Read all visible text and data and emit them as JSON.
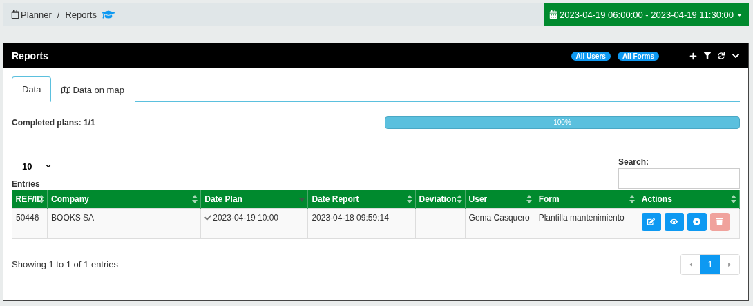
{
  "breadcrumb": {
    "items": [
      "Planner",
      "Reports"
    ],
    "separator": "/"
  },
  "date_range": {
    "label": "2023-04-19 06:00:00 - 2023-04-19 11:30:00"
  },
  "panel": {
    "title": "Reports",
    "badges": [
      "All Users",
      "All Forms"
    ]
  },
  "tabs": [
    {
      "label": "Data",
      "selected": true
    },
    {
      "label": "Data on map",
      "selected": false
    }
  ],
  "progress": {
    "label": "Completed plans: 1/1",
    "level": 1,
    "reading": "100%"
  },
  "page_size": {
    "value": "10",
    "label": "Entries"
  },
  "search": {
    "label": "Search:"
  },
  "table": {
    "columns": [
      {
        "label": "REF/ID",
        "sorted_desc": false
      },
      {
        "label": "Company",
        "sorted_desc": false
      },
      {
        "label": "Date Plan",
        "sorted_desc": true
      },
      {
        "label": "Date Report",
        "sorted_desc": false
      },
      {
        "label": "Deviation",
        "sorted_desc": false
      },
      {
        "label": "User",
        "sorted_desc": false
      },
      {
        "label": "Form",
        "sorted_desc": false
      },
      {
        "label": "Actions",
        "sorted_desc": false
      }
    ],
    "rows": [
      {
        "ref": "50446",
        "company": "BOOKS SA",
        "date_plan": "2023-04-19 10:00",
        "plan_checked": true,
        "date_report": "2023-04-18 09:59:14",
        "user": "Gema Casquero",
        "form": "Plantilla mantenimiento",
        "actions": [
          {
            "kind": "edit",
            "disabled": false
          },
          {
            "kind": "view",
            "disabled": false
          },
          {
            "kind": "target",
            "disabled": false
          },
          {
            "kind": "delete",
            "disabled": true
          }
        ]
      }
    ]
  },
  "footer": {
    "info": "Showing 1 to 1 of 1 entries",
    "pages": [
      {
        "label": "1",
        "selected": true
      }
    ],
    "prev_disabled": true,
    "next_disabled": true
  }
}
